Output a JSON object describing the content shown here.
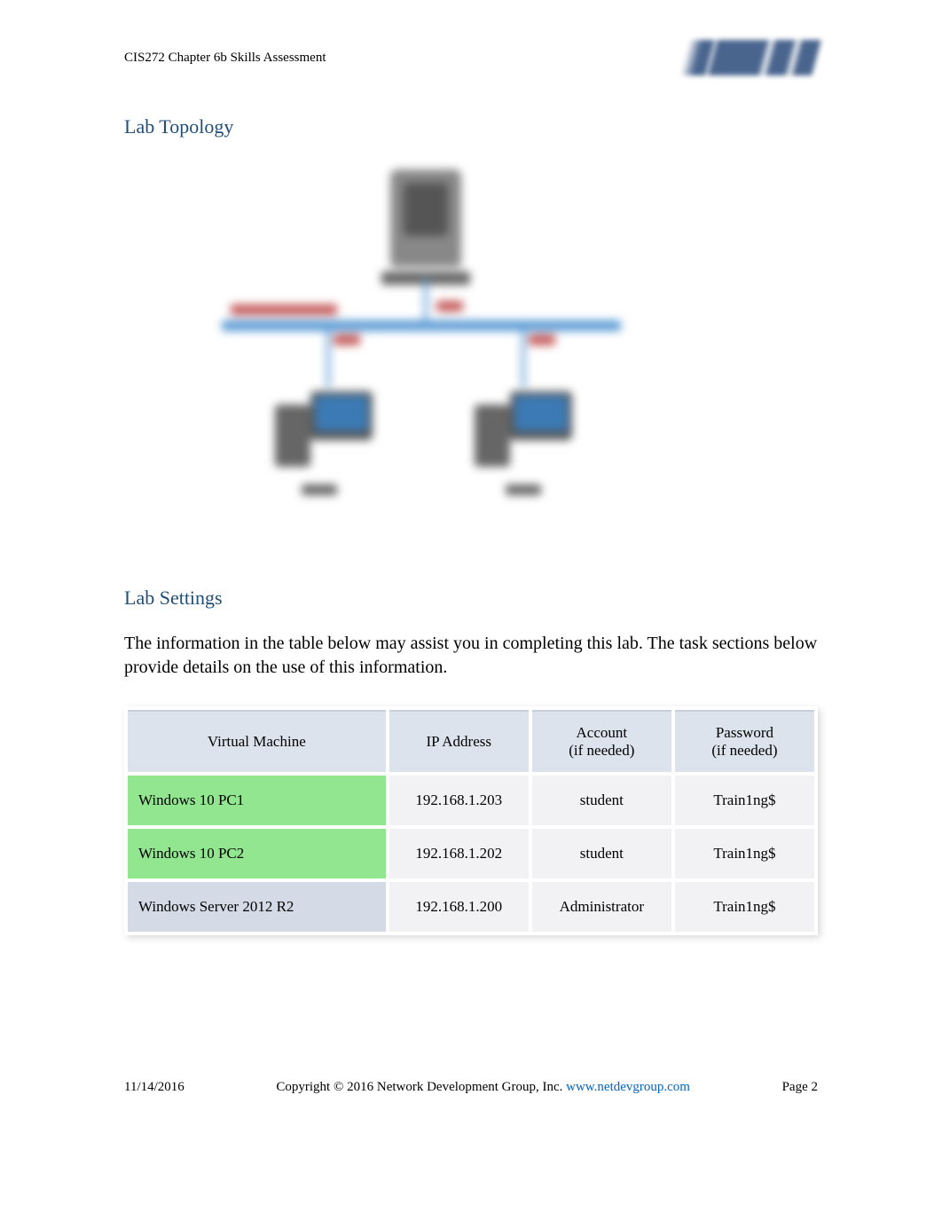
{
  "header": {
    "title": "CIS272 Chapter 6b Skills Assessment"
  },
  "sections": {
    "topology_heading": "Lab Topology",
    "settings_heading": "Lab Settings",
    "settings_desc": "The information in the table below may assist you in completing this lab. The task sections below provide details on the use of this information."
  },
  "table": {
    "headers": {
      "vm": "Virtual Machine",
      "ip": "IP Address",
      "account_l1": "Account",
      "account_l2": "(if needed)",
      "password_l1": "Password",
      "password_l2": "(if needed)"
    },
    "rows": [
      {
        "name": "Windows 10 PC1",
        "ip": "192.168.1.203",
        "account": "student",
        "password": "Train1ng$",
        "style": "green"
      },
      {
        "name": "Windows 10 PC2",
        "ip": "192.168.1.202",
        "account": "student",
        "password": "Train1ng$",
        "style": "green"
      },
      {
        "name": "Windows Server 2012 R2",
        "ip": "192.168.1.200",
        "account": "Administrator",
        "password": "Train1ng$",
        "style": "gray"
      }
    ]
  },
  "footer": {
    "date": "11/14/2016",
    "copyright": "Copyright © 2016 Network Development Group, Inc.",
    "link_text": "www.netdevgroup.com",
    "page": "Page 2"
  }
}
